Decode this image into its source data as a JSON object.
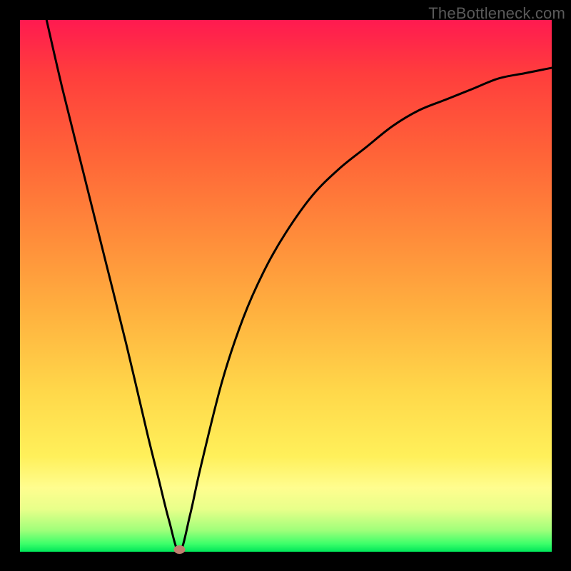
{
  "watermark": {
    "text": "TheBottleneck.com"
  },
  "chart_data": {
    "type": "line",
    "title": "",
    "xlabel": "",
    "ylabel": "",
    "xlim": [
      0,
      100
    ],
    "ylim": [
      0,
      100
    ],
    "x": [
      5,
      8,
      12,
      16,
      20,
      24,
      26,
      28,
      30,
      32,
      34,
      38,
      42,
      46,
      50,
      55,
      60,
      65,
      70,
      75,
      80,
      85,
      90,
      95,
      100
    ],
    "y": [
      100,
      87,
      71,
      55,
      39,
      22,
      14,
      6,
      0,
      7,
      16,
      32,
      44,
      53,
      60,
      67,
      72,
      76,
      80,
      83,
      85,
      87,
      89,
      90,
      91
    ],
    "minimum": {
      "x": 30,
      "y": 0
    },
    "grid": false,
    "legend": false
  },
  "colors": {
    "curve": "#000000",
    "dot": "#c08070",
    "background_top": "#ff1a50",
    "background_bottom": "#00e65a"
  }
}
